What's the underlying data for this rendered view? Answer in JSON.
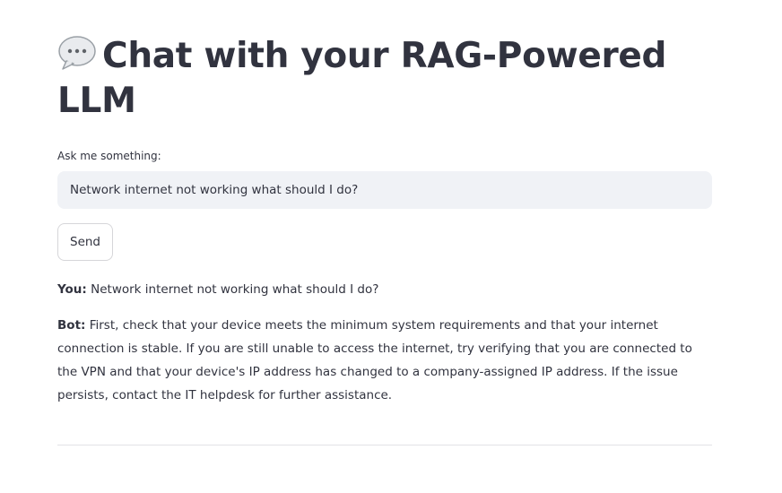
{
  "app": {
    "title": "Chat with your RAG-Powered LLM",
    "title_icon": "speech-balloon-icon"
  },
  "input": {
    "label": "Ask me something:",
    "value": "Network internet not working what should I do?"
  },
  "send_button": {
    "label": "Send"
  },
  "conversation": [
    {
      "speaker": "You:",
      "text": "Network internet not working what should I do?"
    },
    {
      "speaker": "Bot:",
      "text": "First, check that your device meets the minimum system requirements and that your internet connection is stable. If you are still unable to access the internet, try verifying that you are connected to the VPN and that your device's IP address has changed to a company-assigned IP address. If the issue persists, contact the IT helpdesk for further assistance."
    }
  ],
  "colors": {
    "text": "#31333f",
    "input_background": "#f0f2f6",
    "button_border": "#d6d6d9",
    "divider": "#e2e2e6"
  }
}
